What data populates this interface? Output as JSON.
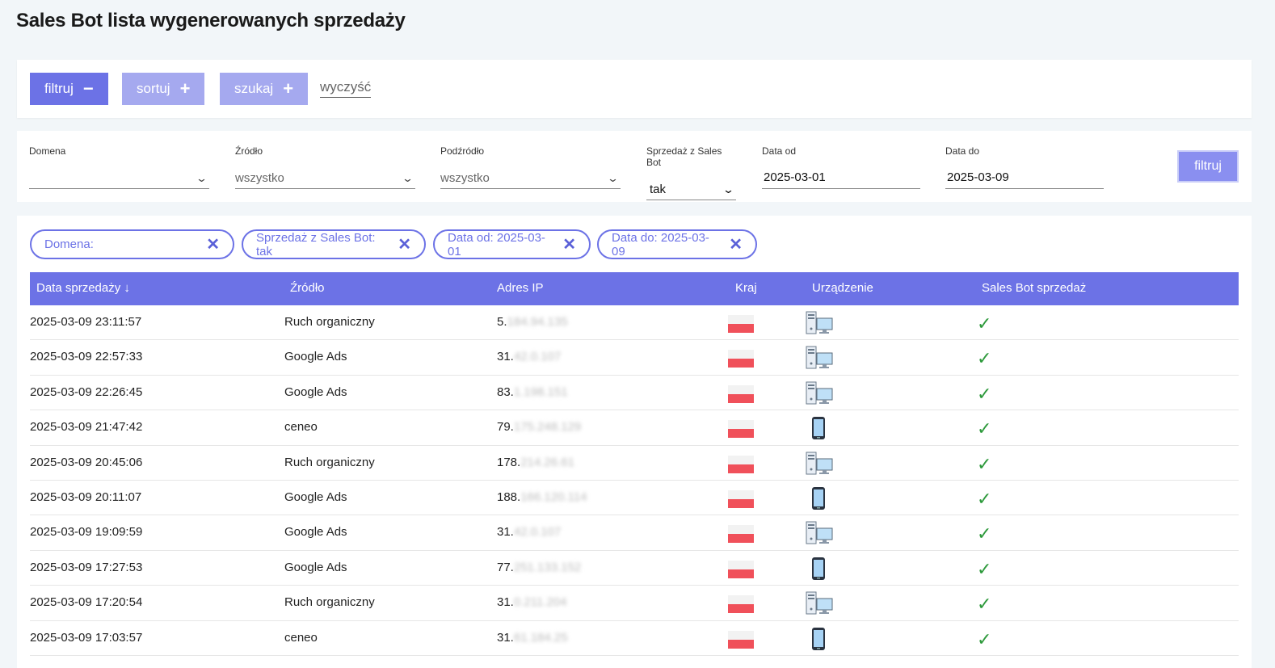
{
  "page": {
    "title": "Sales Bot lista wygenerowanych sprzedaży"
  },
  "toolbar": {
    "filter_label": "filtruj",
    "filter_symbol": "−",
    "sort_label": "sortuj",
    "sort_symbol": "+",
    "search_label": "szukaj",
    "search_symbol": "+",
    "clear_label": "wyczyść"
  },
  "filters": {
    "domain": {
      "label": "Domena",
      "value": ""
    },
    "source": {
      "label": "Źródło",
      "value": "wszystko"
    },
    "subsource": {
      "label": "Podźródło",
      "value": "wszystko"
    },
    "salesbot": {
      "label": "Sprzedaż z Sales Bot",
      "value": "tak"
    },
    "date_from": {
      "label": "Data od",
      "value": "2025-03-01"
    },
    "date_to": {
      "label": "Data do",
      "value": "2025-03-09"
    },
    "submit_label": "filtruj"
  },
  "chips": [
    {
      "label": "Domena:"
    },
    {
      "label": "Sprzedaż z Sales Bot: tak"
    },
    {
      "label": "Data od: 2025-03-01"
    },
    {
      "label": "Data do: 2025-03-09"
    }
  ],
  "chip_close_symbol": "✕",
  "table": {
    "headers": {
      "date": "Data sprzedaży ↓",
      "source": "Źródło",
      "ip": "Adres IP",
      "country": "Kraj",
      "device": "Urządzenie",
      "salesbot": "Sales Bot sprzedaż"
    },
    "check_symbol": "✓",
    "rows": [
      {
        "date": "2025-03-09 23:11:57",
        "source": "Ruch organiczny",
        "ip_prefix": "5.",
        "ip_hidden": "184.94.135",
        "country": "PL",
        "device": "desktop-icon"
      },
      {
        "date": "2025-03-09 22:57:33",
        "source": "Google Ads",
        "ip_prefix": "31.",
        "ip_hidden": "42.0.107",
        "country": "PL",
        "device": "desktop-icon"
      },
      {
        "date": "2025-03-09 22:26:45",
        "source": "Google Ads",
        "ip_prefix": "83.",
        "ip_hidden": "1.198.151",
        "country": "PL",
        "device": "desktop-icon"
      },
      {
        "date": "2025-03-09 21:47:42",
        "source": "ceneo",
        "ip_prefix": "79.",
        "ip_hidden": "175.248.129",
        "country": "PL",
        "device": "mobile-icon"
      },
      {
        "date": "2025-03-09 20:45:06",
        "source": "Ruch organiczny",
        "ip_prefix": "178.",
        "ip_hidden": "214.26.61",
        "country": "PL",
        "device": "desktop-icon"
      },
      {
        "date": "2025-03-09 20:11:07",
        "source": "Google Ads",
        "ip_prefix": "188.",
        "ip_hidden": "166.120.114",
        "country": "PL",
        "device": "mobile-icon"
      },
      {
        "date": "2025-03-09 19:09:59",
        "source": "Google Ads",
        "ip_prefix": "31.",
        "ip_hidden": "42.0.107",
        "country": "PL",
        "device": "desktop-icon"
      },
      {
        "date": "2025-03-09 17:27:53",
        "source": "Google Ads",
        "ip_prefix": "77.",
        "ip_hidden": "251.133.152",
        "country": "PL",
        "device": "mobile-icon"
      },
      {
        "date": "2025-03-09 17:20:54",
        "source": "Ruch organiczny",
        "ip_prefix": "31.",
        "ip_hidden": "0.211.204",
        "country": "PL",
        "device": "desktop-icon"
      },
      {
        "date": "2025-03-09 17:03:57",
        "source": "ceneo",
        "ip_prefix": "31.",
        "ip_hidden": "61.184.25",
        "country": "PL",
        "device": "mobile-icon"
      }
    ]
  },
  "colors": {
    "accent": "#6c72e6",
    "accent_light": "#a5a9ef",
    "check": "#2e9a3c",
    "flag_red": "#f0505a"
  }
}
